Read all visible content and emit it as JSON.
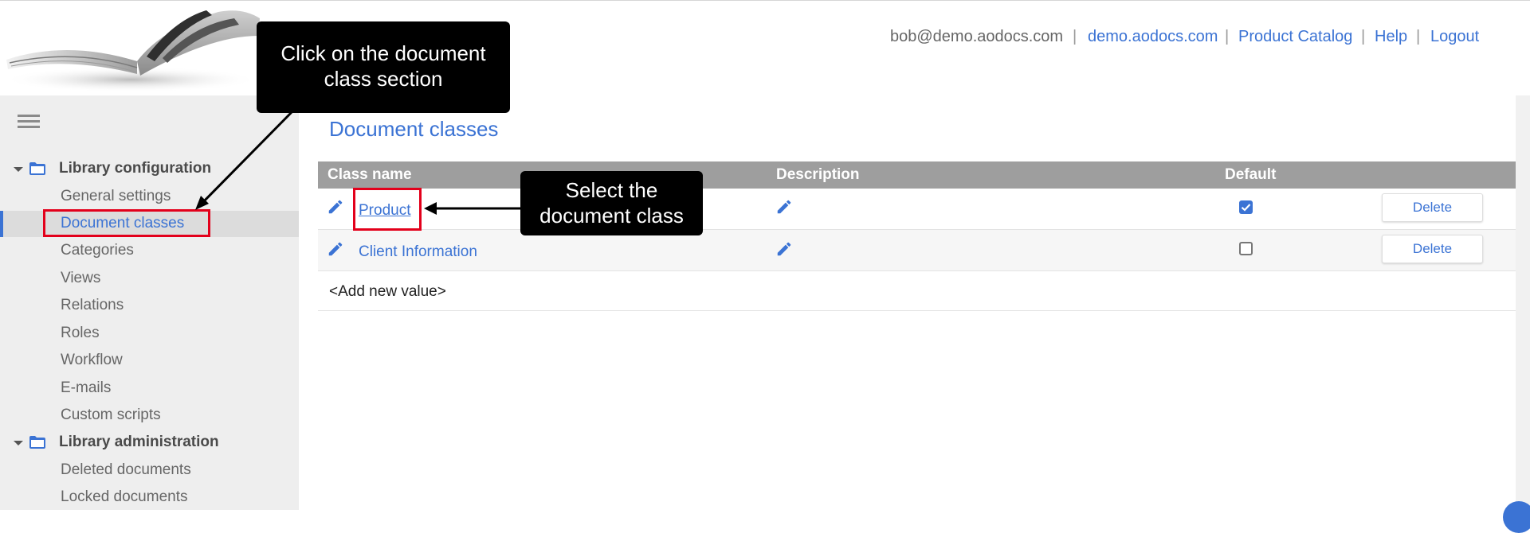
{
  "header": {
    "user_email": "bob@demo.aodocs.com",
    "domain_link": "demo.aodocs.com",
    "product_catalog_link": "Product Catalog",
    "help_link": "Help",
    "logout_link": "Logout",
    "separator": "|"
  },
  "sidebar": {
    "groups": [
      {
        "label": "Library configuration",
        "items": [
          "General settings",
          "Document classes",
          "Categories",
          "Views",
          "Relations",
          "Roles",
          "Workflow",
          "E-mails",
          "Custom scripts"
        ]
      },
      {
        "label": "Library administration",
        "items": [
          "Deleted documents",
          "Locked documents"
        ]
      }
    ],
    "active_item": "Document classes"
  },
  "main": {
    "title": "Document classes",
    "columns": [
      "Class name",
      "Description",
      "Default"
    ],
    "rows": [
      {
        "class_name": "Product",
        "default": true,
        "action": "Delete"
      },
      {
        "class_name": "Client Information",
        "default": false,
        "action": "Delete"
      }
    ],
    "add_new": "<Add new value>"
  },
  "annotations": {
    "callout_1": [
      "Click on the document",
      "class section"
    ],
    "callout_2": [
      "Select the",
      "document class"
    ]
  },
  "colors": {
    "accent": "#3b73d4",
    "highlight": "#e3001b",
    "table_header": "#9e9e9e",
    "sidebar_bg": "#eeeeee"
  }
}
